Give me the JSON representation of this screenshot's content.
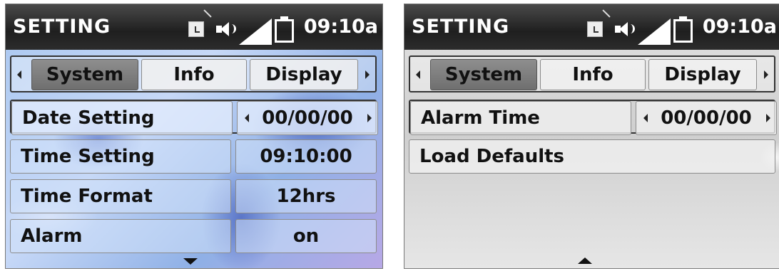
{
  "left": {
    "title": "SETTING",
    "time": "09:10a",
    "tabs": [
      "System",
      "Info",
      "Display"
    ],
    "rows": [
      {
        "label": "Date Setting",
        "value": "00/00/00"
      },
      {
        "label": "Time Setting",
        "value": "09:10:00"
      },
      {
        "label": "Time Format",
        "value": "12hrs"
      },
      {
        "label": "Alarm",
        "value": "on"
      }
    ]
  },
  "right": {
    "title": "SETTING",
    "time": "09:10a",
    "tabs": [
      "System",
      "Info",
      "Display"
    ],
    "rows": [
      {
        "label": "Alarm Time",
        "value": "00/00/00"
      },
      {
        "label": "Load Defaults"
      }
    ]
  },
  "icons": [
    "memory-card-icon",
    "speaker-icon",
    "signal-icon",
    "battery-icon",
    "scroll-down-arrow-icon",
    "scroll-up-arrow-icon"
  ]
}
